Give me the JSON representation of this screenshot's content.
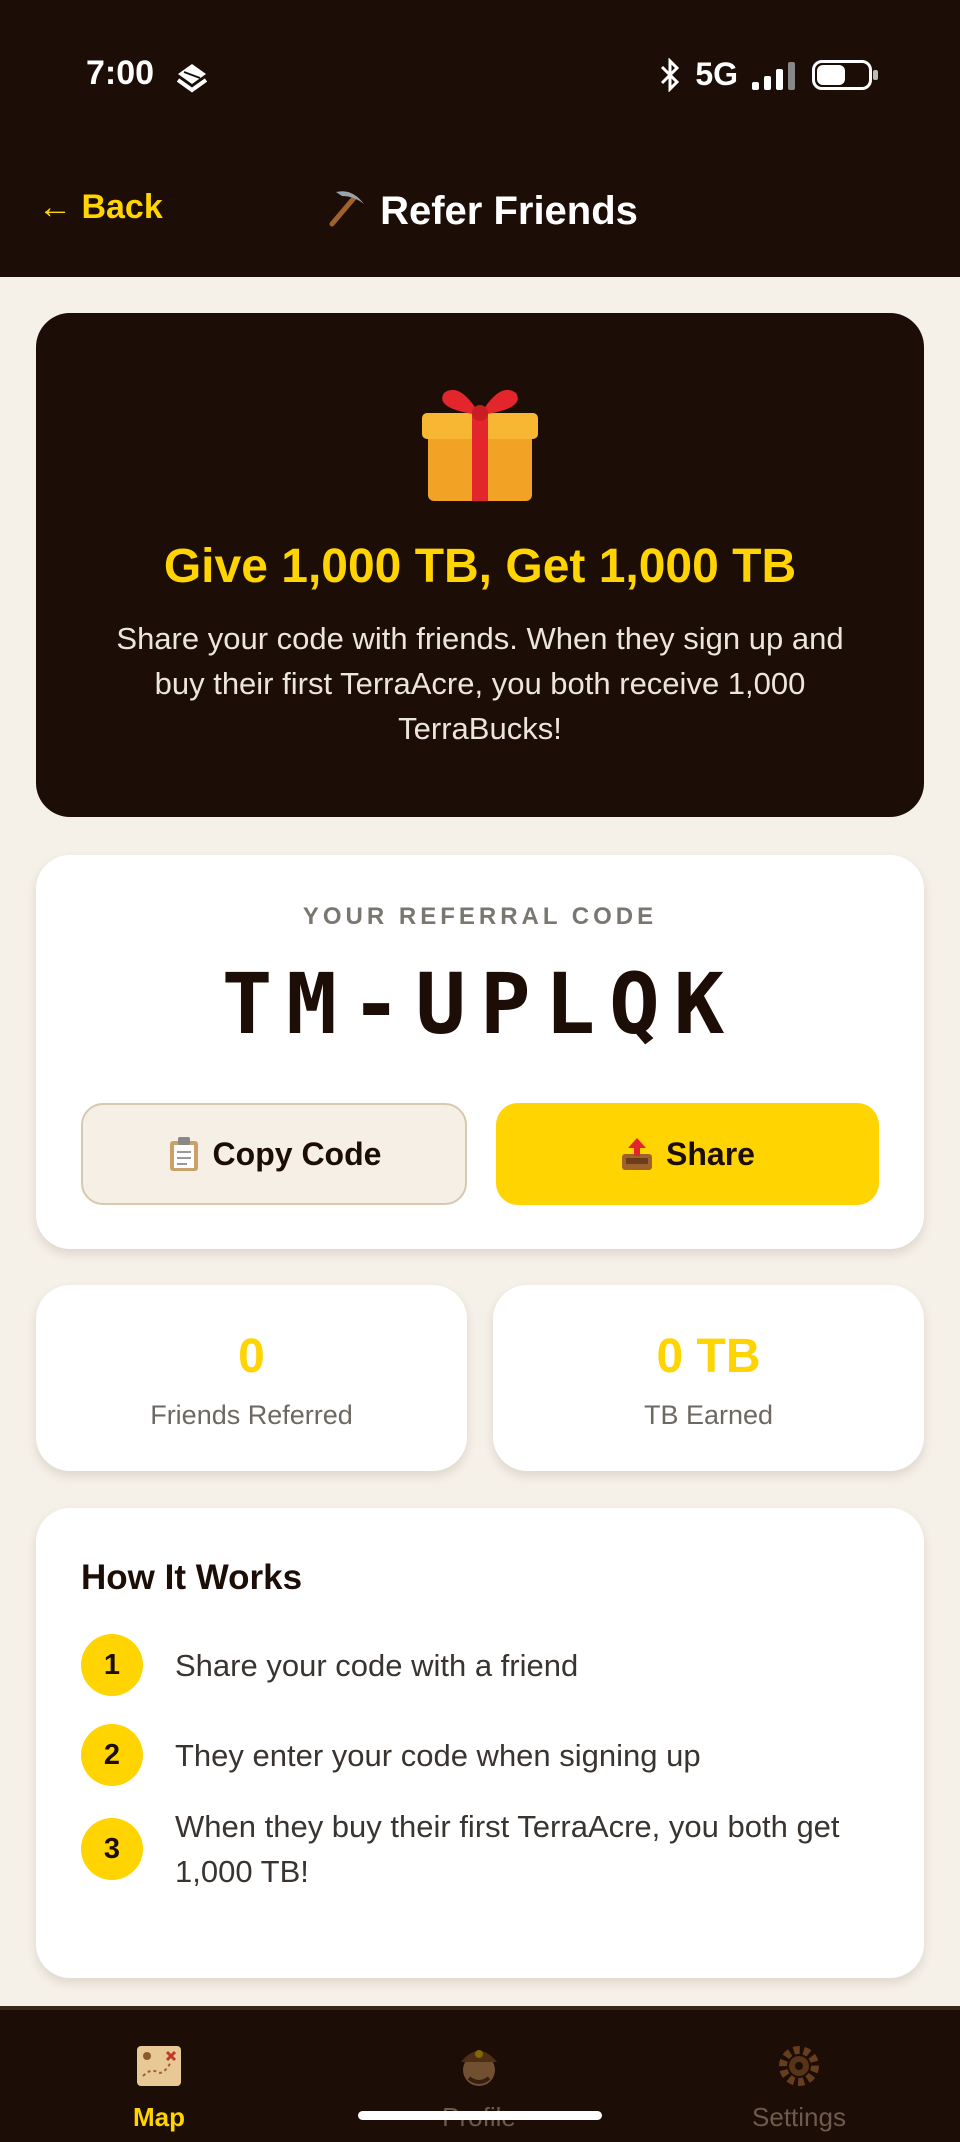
{
  "status_bar": {
    "time": "7:00",
    "network": "5G",
    "app_icon": "stacked-layers-icon",
    "icons": [
      "bluetooth-icon",
      "signal-icon",
      "battery-icon"
    ],
    "battery_level": 0.6
  },
  "header": {
    "back_label": "← Back",
    "title": "Refer Friends",
    "title_icon": "pickaxe-icon"
  },
  "hero": {
    "icon": "gift-icon",
    "title": "Give 1,000 TB, Get 1,000 TB",
    "description": "Share your code with friends. When they sign up and buy their first TerraAcre, you both receive 1,000 TerraBucks!"
  },
  "referral": {
    "label": "YOUR REFERRAL CODE",
    "code": "TM-UPLQK",
    "copy_label": "Copy Code",
    "copy_icon": "clipboard-icon",
    "share_label": "Share",
    "share_icon": "outbox-tray-icon"
  },
  "stats": [
    {
      "value": "0",
      "label": "Friends Referred"
    },
    {
      "value": "0 TB",
      "label": "TB Earned"
    }
  ],
  "how_it_works": {
    "title": "How It Works",
    "steps": [
      {
        "number": "1",
        "text": "Share your code with a friend"
      },
      {
        "number": "2",
        "text": "They enter your code when signing up"
      },
      {
        "number": "3",
        "text": "When they buy their first TerraAcre, you both get 1,000 TB!"
      }
    ]
  },
  "bottom_nav": [
    {
      "label": "Map",
      "icon": "treasure-map-icon",
      "active": true
    },
    {
      "label": "Profile",
      "icon": "miner-avatar-icon",
      "active": false
    },
    {
      "label": "Settings",
      "icon": "gear-icon",
      "active": false
    }
  ],
  "colors": {
    "dark": "#1c0d06",
    "accent": "#ffd400",
    "background": "#f5f0e8"
  }
}
